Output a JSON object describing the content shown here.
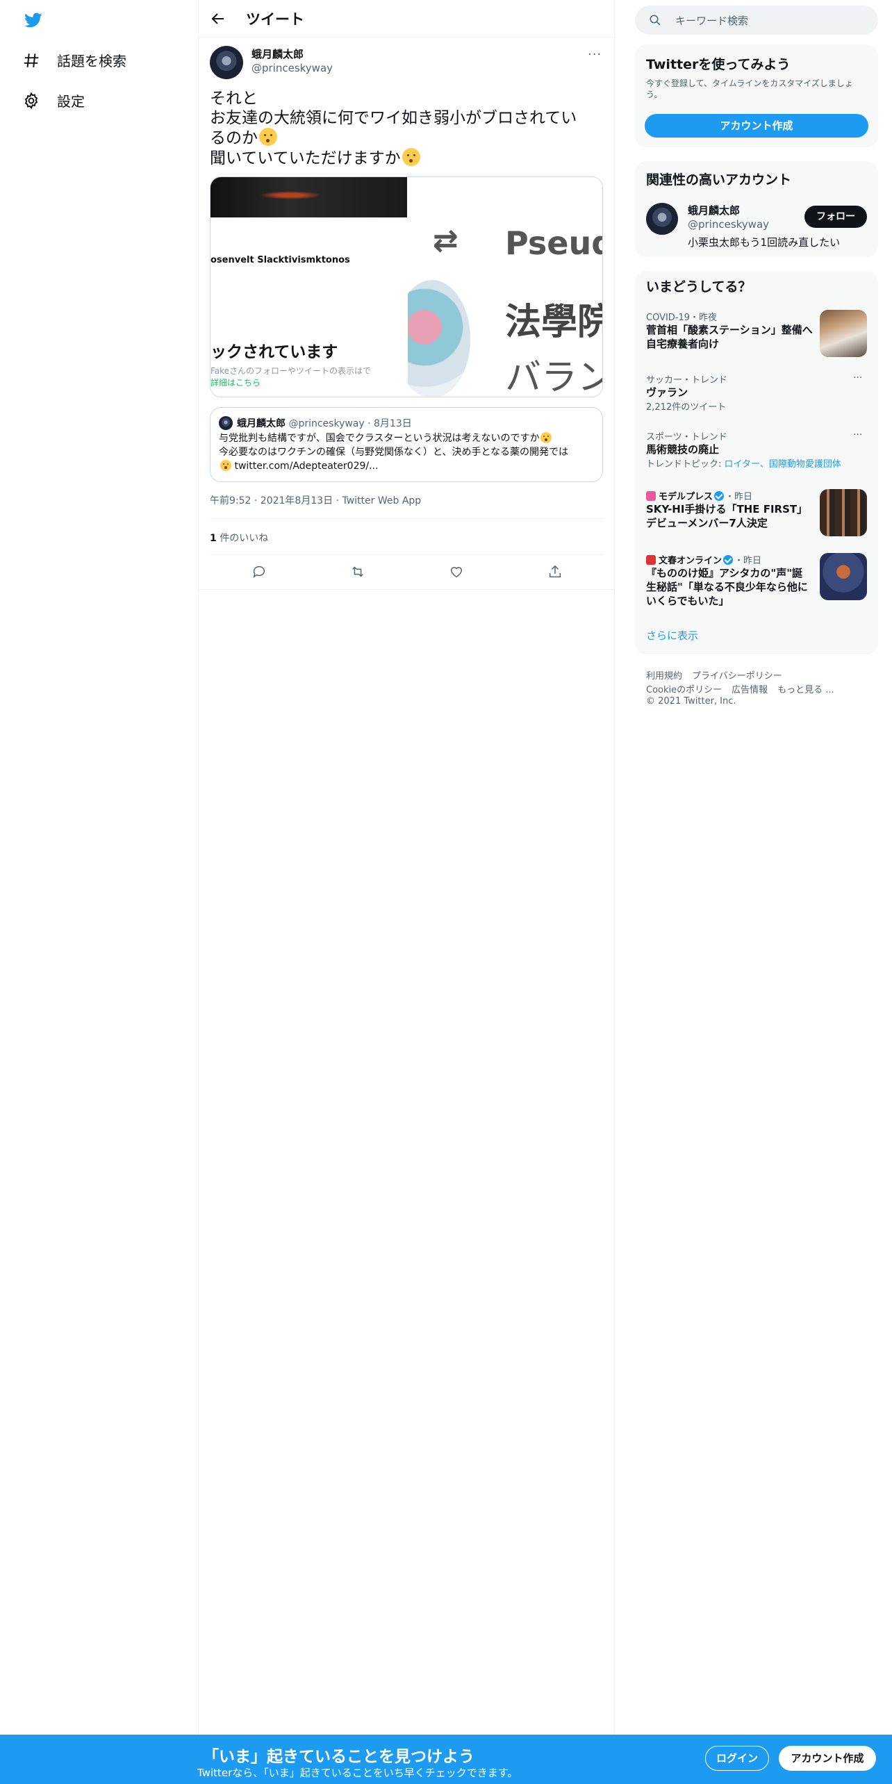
{
  "nav": {
    "explore_label": "話題を検索",
    "settings_label": "設定"
  },
  "header": {
    "title": "ツイート"
  },
  "tweet": {
    "author_name": "蛾月麟太郎",
    "author_handle": "@princeskyway",
    "more": "···",
    "lines": [
      "それと",
      "お友達の大統領に何でワイ如き弱小がブロされてい",
      "るのか",
      "聞いていていただけますか"
    ],
    "media": {
      "left_name": "osenvelt Slacktivismktonos",
      "left_blocked": "ックされています",
      "left_sub": "Fakeさんのフォローやツイートの表示はで",
      "left_link": "詳細はこちら",
      "right_word": "Pseudo",
      "right_kanji1": "法學院",
      "right_kanji2": "バラン"
    },
    "quote": {
      "name": "蛾月麟太郎",
      "handle_date": "@princeskyway · 8月13日",
      "line1": "与党批判も結構ですが、国会でクラスターという状況は考えないのですか",
      "line2": "今必要なのはワクチンの確保（与野党関係なく）と、決め手となる薬の開発では",
      "line3": "twitter.com/Adepteater029/..."
    },
    "meta": "午前9:52 · 2021年8月13日 · Twitter Web App",
    "likes_count": "1",
    "likes_label": " 件のいいね"
  },
  "search": {
    "placeholder": "キーワード検索"
  },
  "signup_card": {
    "title": "Twitterを使ってみよう",
    "desc": "今すぐ登録して、タイムラインをカスタマイズしましょう。",
    "button": "アカウント作成"
  },
  "related": {
    "title": "関連性の高いアカウント",
    "name": "蛾月麟太郎",
    "handle": "@princeskyway",
    "bio": "小栗虫太郎もう1回読み直したい",
    "follow": "フォロー"
  },
  "trends": {
    "title": "いまどうしてる？",
    "items": [
      {
        "cat": "COVID-19・昨夜",
        "title": "菅首相「酸素ステーション」整備へ 自宅療養者向け"
      },
      {
        "cat": "サッカー・トレンド",
        "title": "ヴァラン",
        "sub": "2,212件のツイート"
      },
      {
        "cat": "スポーツ・トレンド",
        "title": "馬術競技の廃止",
        "sub_prefix": "トレンドトピック: ",
        "sub_link": "ロイター、国際動物愛護団体"
      },
      {
        "source": "モデルプレス",
        "time": "・昨日",
        "title": "SKY-HI手掛ける「THE FIRST」デビューメンバー7人決定"
      },
      {
        "source": "文春オンライン",
        "time": "・昨日",
        "title": "『もののけ姫』アシタカの\"声\"誕生秘話\"「単なる不良少年なら他にいくらでもいた」"
      }
    ],
    "show_more": "さらに表示"
  },
  "footer": {
    "links1": [
      "利用規約",
      "プライバシーポリシー"
    ],
    "links2": [
      "Cookieのポリシー",
      "広告情報",
      "もっと見る ..."
    ],
    "copyright": "© 2021 Twitter, Inc."
  },
  "bottom": {
    "title": "「いま」起きていることを見つけよう",
    "sub": "Twitterなら、「いま」起きていることをいち早くチェックできます。",
    "login": "ログイン",
    "signup": "アカウント作成"
  },
  "colors": {
    "accent": "#1d9bf0",
    "text": "#0f1419",
    "secondary": "#536471"
  }
}
